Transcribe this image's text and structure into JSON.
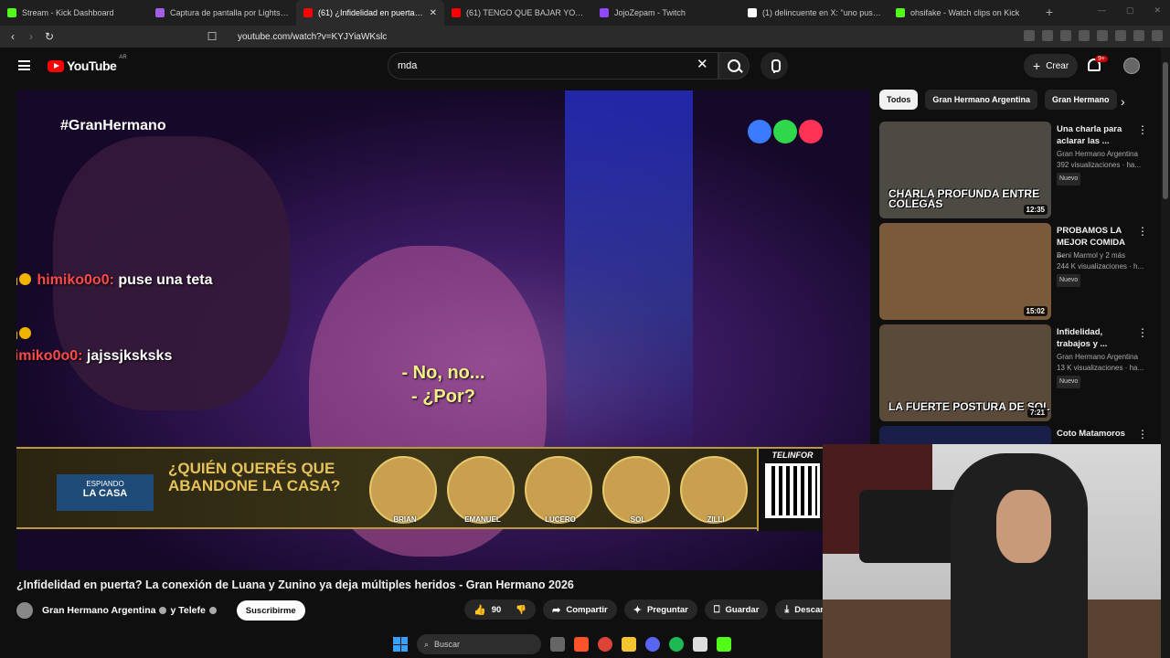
{
  "browser": {
    "tabs": [
      {
        "label": "Stream - Kick Dashboard",
        "color": "#53fc18"
      },
      {
        "label": "Captura de pantalla por Lightshot",
        "color": "#a45ee5"
      },
      {
        "label": "(61) ¿Infidelidad en puerta? La c",
        "color": "#ff0000",
        "active": true
      },
      {
        "label": "(61) TENGO QUE BAJAR YO A ARREG",
        "color": "#ff0000"
      },
      {
        "label": "JojoZepam - Twitch",
        "color": "#9146ff"
      },
      {
        "label": "(1) delincuente en X: \"uno puso que",
        "color": "#ffffff"
      },
      {
        "label": "ohsifake - Watch clips on Kick",
        "color": "#53fc18"
      }
    ],
    "url": "youtube.com/watch?v=KYJYiaWKslc"
  },
  "header": {
    "logo_text": "YouTube",
    "country_code": "AR",
    "search_value": "mda",
    "create_label": "Crear",
    "notif_badge": "9+"
  },
  "video": {
    "hashtag": "#GranHermano",
    "channel_colors": [
      "#3a7bff",
      "#2ed84a",
      "#ff3355"
    ],
    "chat": [
      {
        "user": "himiko0o0:",
        "message": "puse una teta",
        "badge_num": "1"
      },
      {
        "user": "himiko0o0:",
        "message": "jajssjksksks",
        "badge_num": "1"
      }
    ],
    "subtitles": [
      "- No, no...",
      "- ¿Por?"
    ],
    "banner": {
      "tag_small": "ESPIANDO",
      "tag_big": "LA CASA",
      "question": "¿QUIÉN QUERÉS QUE ABANDONE LA CASA?",
      "candidates": [
        "BRIAN",
        "EMANUEL",
        "LUCERO",
        "SOL",
        "ZILLI"
      ],
      "brand": "TELINFOR"
    }
  },
  "meta": {
    "title": "¿Infidelidad en puerta? La conexión de Luana y Zunino ya deja múltiples heridos - Gran Hermano 2026",
    "channel": "Gran Hermano Argentina",
    "and_channel": "y Telefe",
    "subscribe": "Suscribirme",
    "likes": "90",
    "share": "Compartir",
    "ask": "Preguntar",
    "save": "Guardar",
    "download": "Descar"
  },
  "sidebar": {
    "chips": [
      "Todos",
      "Gran Hermano Argentina",
      "Gran Hermano"
    ],
    "recs": [
      {
        "title": "Una charla para aclarar las ...",
        "channel": "Gran Hermano Argentina",
        "views": "392 visualizaciones · ha...",
        "badge": "Nuevo",
        "thumb_text": "CHARLA PROFUNDA ENTRE COLEGAS",
        "duration": "12:35",
        "thumb_color": "#4d4a44"
      },
      {
        "title": "PROBAMOS LA MEJOR COMIDA ...",
        "channel": "Beni Marmol y 2 más",
        "views": "244 K visualizaciones · h...",
        "badge": "Nuevo",
        "thumb_text": "",
        "duration": "15:02",
        "thumb_color": "#7a5a3a"
      },
      {
        "title": "Infidelidad, trabajos y ...",
        "channel": "Gran Hermano Argentina",
        "views": "13 K visualizaciones · ha...",
        "badge": "Nuevo",
        "thumb_text": "LA FUERTE POSTURA DE SOL",
        "duration": "7:21",
        "thumb_color": "#5a4a3a"
      },
      {
        "title": "Coto Matamoros",
        "channel": "",
        "views": "",
        "badge": "",
        "thumb_text": "",
        "duration": "",
        "thumb_color": "#1a1f4a"
      }
    ]
  },
  "taskbar": {
    "search_label": "Buscar"
  }
}
